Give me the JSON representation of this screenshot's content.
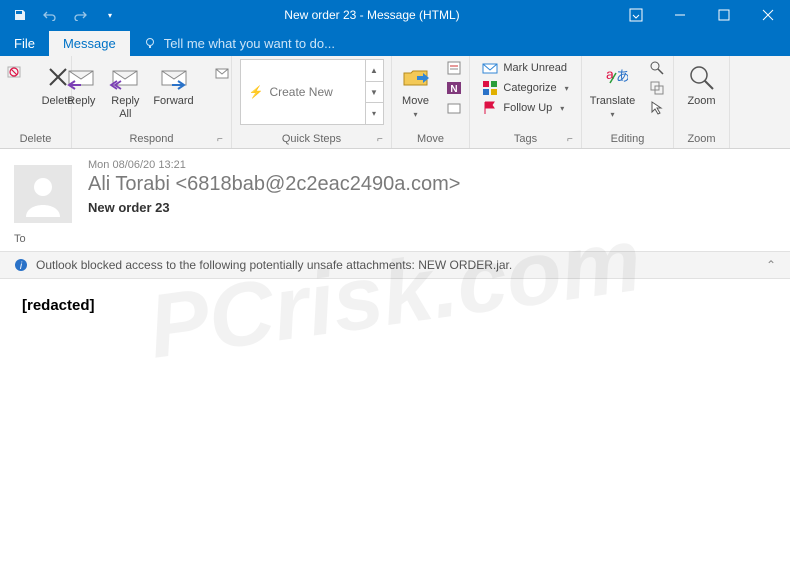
{
  "window": {
    "title": "New order 23 - Message (HTML)"
  },
  "tabs": {
    "file": "File",
    "message": "Message",
    "tellme": "Tell me what you want to do..."
  },
  "ribbon": {
    "delete_group": "Delete",
    "delete": "Delete",
    "respond_group": "Respond",
    "reply": "Reply",
    "reply_all": "Reply\nAll",
    "forward": "Forward",
    "quicksteps_group": "Quick Steps",
    "create_new": "Create New",
    "move_group": "Move",
    "move": "Move",
    "tags_group": "Tags",
    "mark_unread": "Mark Unread",
    "categorize": "Categorize",
    "follow_up": "Follow Up",
    "editing_group": "Editing",
    "translate": "Translate",
    "zoom_group": "Zoom",
    "zoom": "Zoom"
  },
  "message": {
    "date": "Mon 08/06/20 13:21",
    "from": "Ali Torabi <6818bab@2c2eac2490a.com>",
    "subject": "New order 23",
    "to_label": "To",
    "infobar": "Outlook blocked access to the following potentially unsafe attachments: NEW ORDER.jar.",
    "body": "[redacted]"
  },
  "watermark": "PCrisk.com"
}
